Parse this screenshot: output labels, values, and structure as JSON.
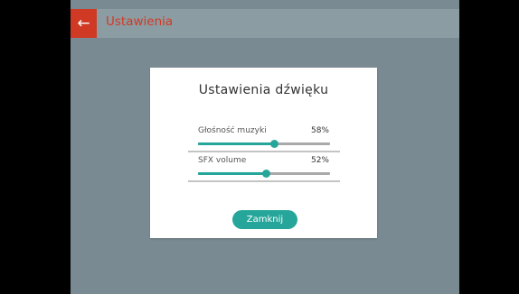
{
  "topbar": {
    "title": "Ustawienia",
    "back_icon": "←"
  },
  "dialog": {
    "title": "Ustawienia dźwięku",
    "settings": [
      {
        "label": "Głośność muzyki",
        "value_text": "58%",
        "level": 0.58
      },
      {
        "label": "SFX volume",
        "value_text": "52%",
        "level": 0.52
      }
    ],
    "close_label": "Zamknij"
  },
  "colors": {
    "accent": "#26a69a",
    "brand": "#d03a24",
    "backdrop": "#798a92",
    "topbar": "#8c9ca3"
  }
}
